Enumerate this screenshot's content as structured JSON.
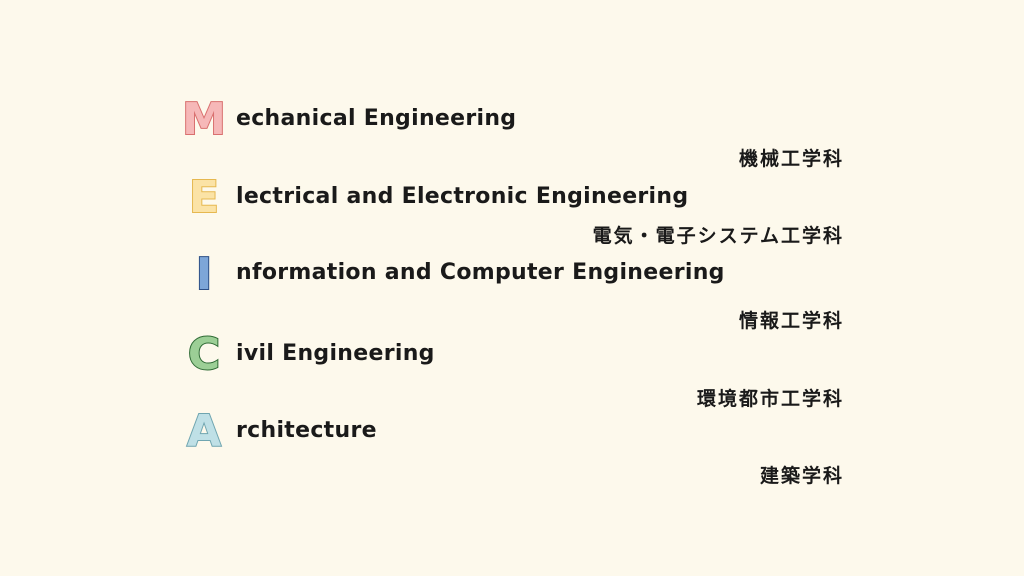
{
  "departments": [
    {
      "initial": "M",
      "initial_fill": "#f6b8b8",
      "initial_stroke": "#d9706f",
      "rest": "echanical Engineering",
      "japanese": "機械工学科"
    },
    {
      "initial": "E",
      "initial_fill": "#fbe3a6",
      "initial_stroke": "#e6b84f",
      "rest": "lectrical and Electronic Engineering",
      "japanese": "電気・電子システム工学科"
    },
    {
      "initial": "I",
      "initial_fill": "#7da6d8",
      "initial_stroke": "#2d4f86",
      "rest": "nformation and Computer Engineering",
      "japanese": "情報工学科"
    },
    {
      "initial": "C",
      "initial_fill": "#9ccf96",
      "initial_stroke": "#2f6b35",
      "rest": "ivil Engineering",
      "japanese": "環境都市工学科"
    },
    {
      "initial": "A",
      "initial_fill": "#bfe0e6",
      "initial_stroke": "#6fa5b0",
      "rest": "rchitecture",
      "japanese": "建築学科"
    }
  ]
}
